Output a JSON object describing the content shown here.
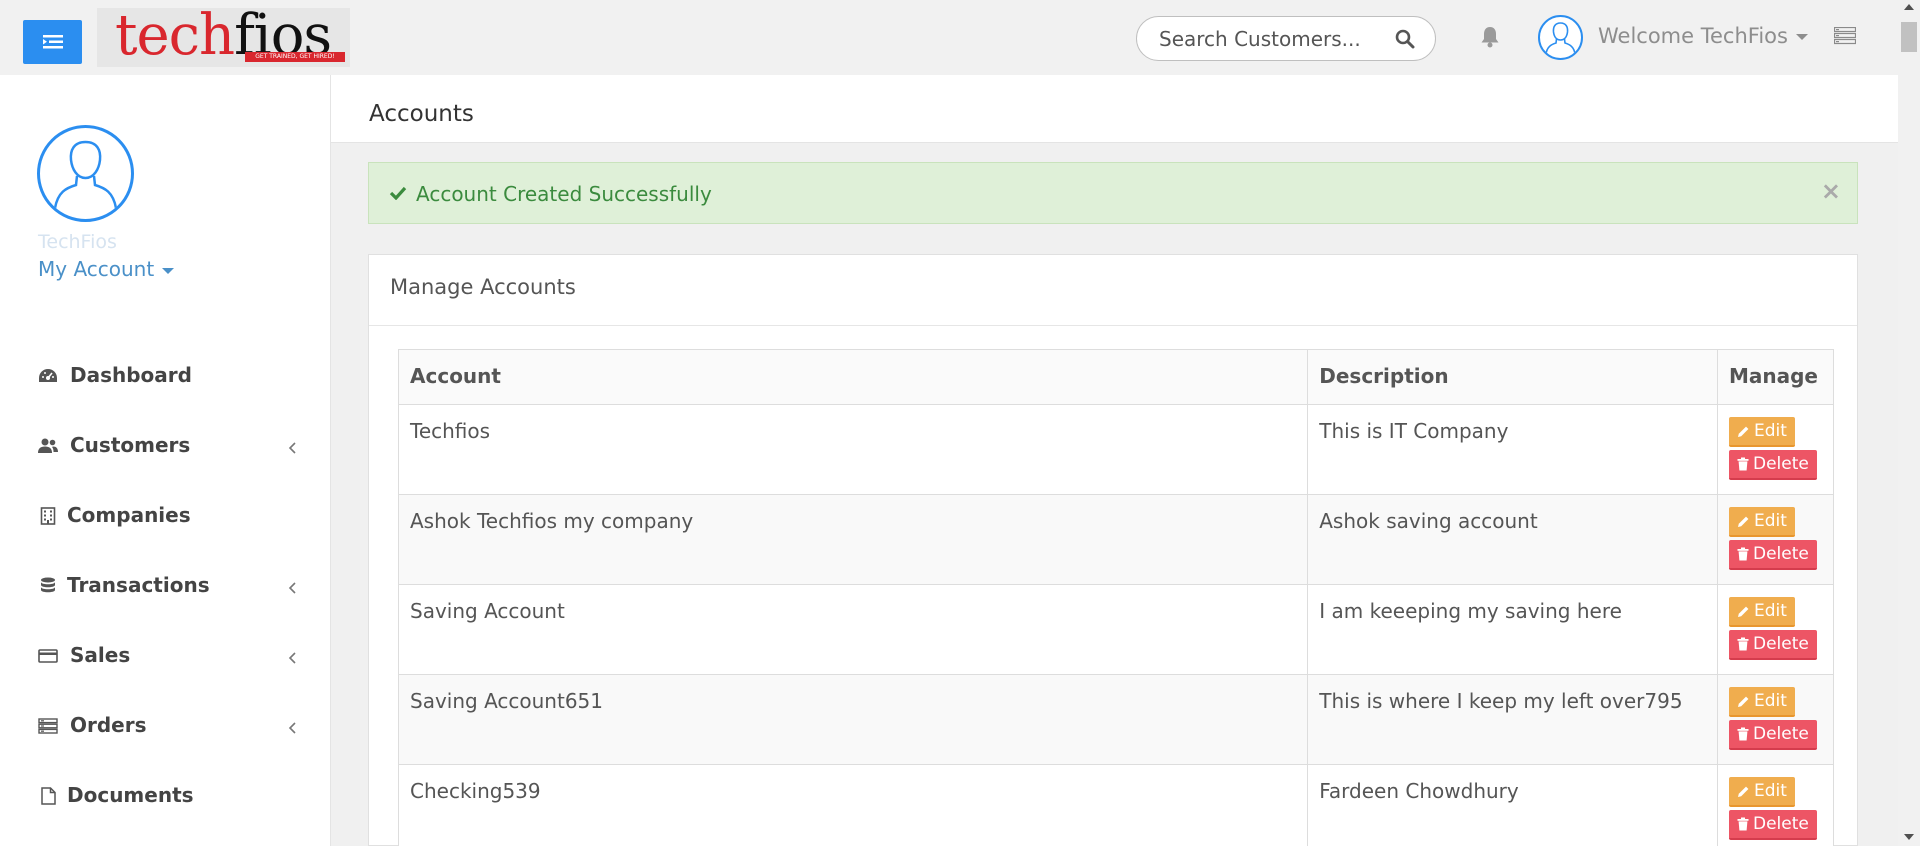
{
  "header": {
    "logo": {
      "text_red": "tech",
      "text_dark": "fios",
      "tagline": "GET TRAINED, GET HIRED!"
    },
    "search": {
      "placeholder": "Search Customers..."
    },
    "welcome": "Welcome TechFios",
    "icons": [
      "menu-toggle-icon",
      "search-icon",
      "bell-icon",
      "user-avatar-icon",
      "grid-list-icon"
    ],
    "accent_color": "#2b8ef0"
  },
  "sidebar": {
    "username": "TechFios",
    "my_account": "My Account",
    "items": [
      {
        "label": "Dashboard",
        "icon": "dashboard-icon",
        "has_submenu": false
      },
      {
        "label": "Customers",
        "icon": "users-icon",
        "has_submenu": true
      },
      {
        "label": "Companies",
        "icon": "building-icon",
        "has_submenu": false
      },
      {
        "label": "Transactions",
        "icon": "database-icon",
        "has_submenu": true
      },
      {
        "label": "Sales",
        "icon": "credit-card-icon",
        "has_submenu": true
      },
      {
        "label": "Orders",
        "icon": "server-icon",
        "has_submenu": true
      },
      {
        "label": "Documents",
        "icon": "file-icon",
        "has_submenu": false
      }
    ]
  },
  "main": {
    "title": "Accounts",
    "alert": {
      "message": "Account Created Successfully",
      "close": "×",
      "color": "#dff0d8"
    },
    "panel_title": "Manage Accounts",
    "table": {
      "headers": [
        "Account",
        "Description",
        "Manage"
      ],
      "rows": [
        {
          "account": "Techfios",
          "description": "This is IT Company"
        },
        {
          "account": "Ashok Techfios my company",
          "description": "Ashok saving account"
        },
        {
          "account": "Saving Account",
          "description": "I am keeeping my saving here"
        },
        {
          "account": "Saving Account651",
          "description": "This is where I keep my left over795"
        },
        {
          "account": "Checking539",
          "description": "Fardeen Chowdhury"
        }
      ],
      "edit_label": "Edit",
      "delete_label": "Delete",
      "edit_color": "#f0ad4e",
      "delete_color": "#ed5565"
    }
  }
}
